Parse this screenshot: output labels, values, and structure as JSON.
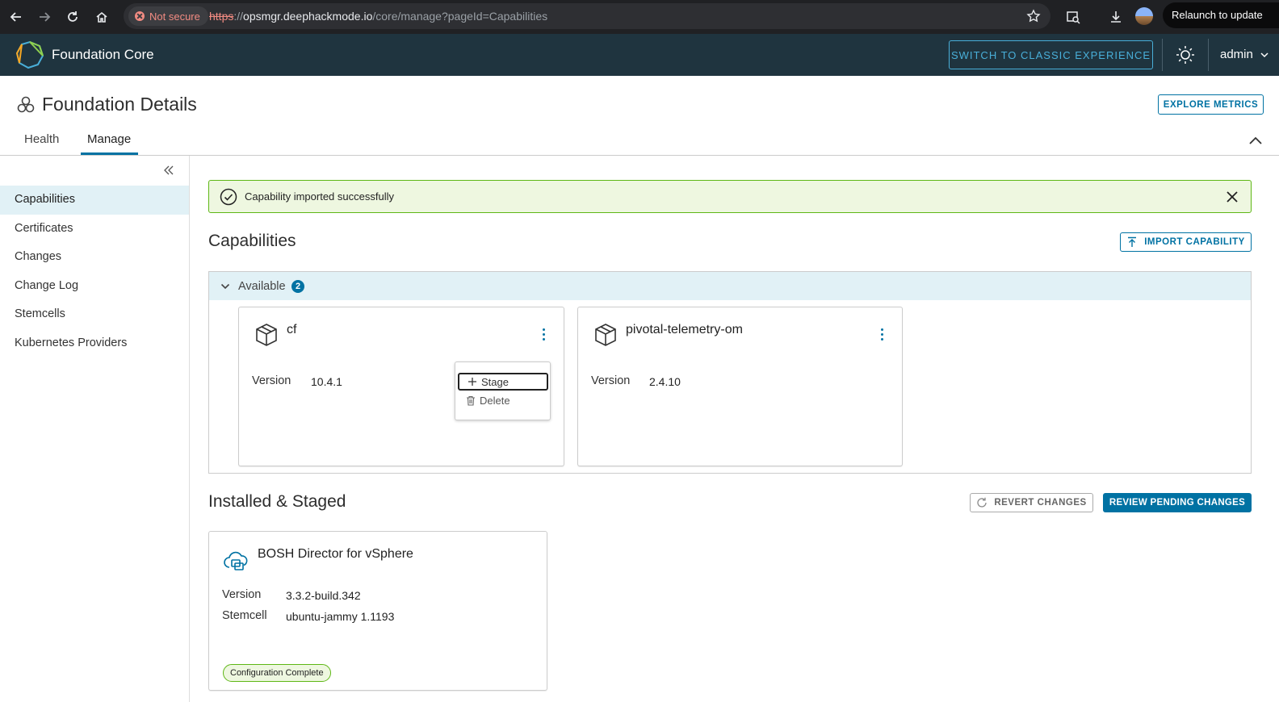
{
  "browser": {
    "not_secure_label": "Not secure",
    "url_protocol": "https",
    "url_separator": "://",
    "url_host": "opsmgr.deephackmode.io",
    "url_path": "/core/manage?pageId=Capabilities",
    "relaunch_label": "Relaunch to update"
  },
  "header": {
    "app_title": "Foundation Core",
    "switch_label": "SWITCH TO CLASSIC EXPERIENCE",
    "user": "admin"
  },
  "page": {
    "title": "Foundation Details",
    "explore_label": "EXPLORE METRICS",
    "tabs": [
      {
        "label": "Health"
      },
      {
        "label": "Manage"
      }
    ]
  },
  "sidebar": {
    "items": [
      {
        "label": "Capabilities"
      },
      {
        "label": "Certificates"
      },
      {
        "label": "Changes"
      },
      {
        "label": "Change Log"
      },
      {
        "label": "Stemcells"
      },
      {
        "label": "Kubernetes Providers"
      }
    ]
  },
  "alert": {
    "message": "Capability imported successfully"
  },
  "capabilities": {
    "title": "Capabilities",
    "import_label": "IMPORT CAPABILITY",
    "available_label": "Available",
    "available_count": "2",
    "cards": [
      {
        "name": "cf",
        "version_label": "Version",
        "version": "10.4.1"
      },
      {
        "name": "pivotal-telemetry-om",
        "version_label": "Version",
        "version": "2.4.10"
      }
    ],
    "menu": {
      "stage": "Stage",
      "delete": "Delete"
    }
  },
  "installed": {
    "title": "Installed & Staged",
    "revert_label": "REVERT CHANGES",
    "review_label": "REVIEW PENDING CHANGES",
    "card": {
      "name": "BOSH Director for vSphere",
      "version_label": "Version",
      "version": "3.3.2-build.342",
      "stemcell_label": "Stemcell",
      "stemcell": "ubuntu-jammy 1.1193",
      "status": "Configuration Complete"
    }
  },
  "colors": {
    "accent": "#0072a3",
    "header_bg": "#1f343f",
    "success_border": "#5eb715",
    "success_bg": "#eef7e0",
    "selected_bg": "#e1f1f6"
  }
}
